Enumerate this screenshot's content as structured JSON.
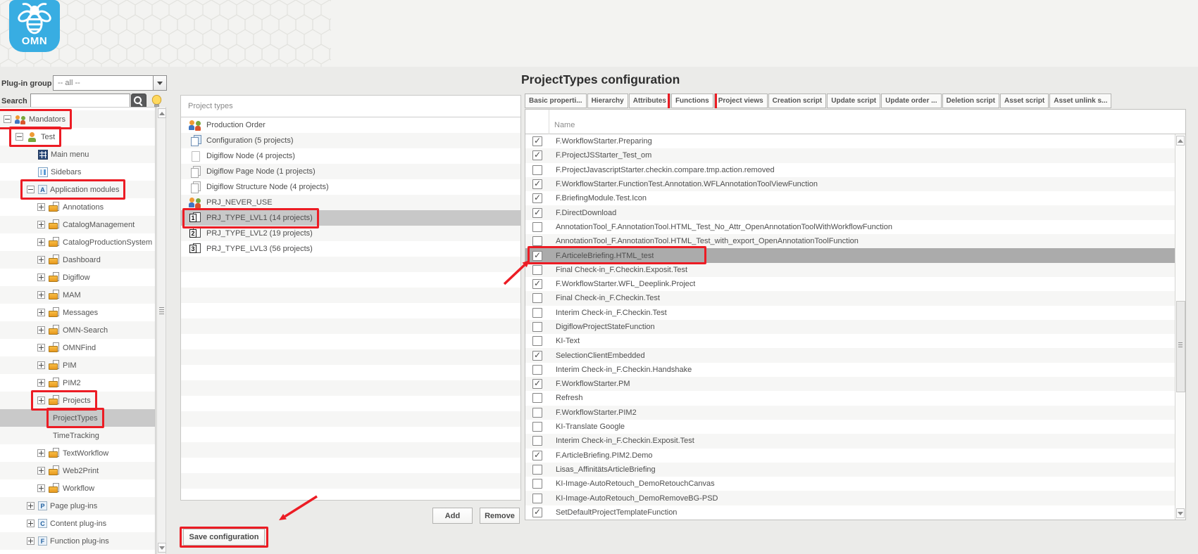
{
  "header": {
    "logo_text": "OMN"
  },
  "title": "ProjectTypes configuration",
  "sidebar": {
    "plugin_group_label": "Plug-in group",
    "plugin_group_value": "-- all --",
    "search_label": "Search",
    "search_value": "",
    "tree": [
      {
        "label": "Mandators",
        "level": 0,
        "expander": "minus",
        "icon": "users",
        "annotated": true
      },
      {
        "label": "Test",
        "level": 1,
        "expander": "minus",
        "icon": "person",
        "annotated": true
      },
      {
        "label": "Main menu",
        "level": 2,
        "expander": "none",
        "icon": "menu"
      },
      {
        "label": "Sidebars",
        "level": 2,
        "expander": "none",
        "icon": "sidebars"
      },
      {
        "label": "Application modules",
        "level": 2,
        "expander": "minus",
        "icon": "letter",
        "letter": "A",
        "annotated": true
      },
      {
        "label": "Annotations",
        "level": 3,
        "expander": "plus",
        "icon": "folder"
      },
      {
        "label": "CatalogManagement",
        "level": 3,
        "expander": "plus",
        "icon": "folder"
      },
      {
        "label": "CatalogProductionSystem",
        "level": 3,
        "expander": "plus",
        "icon": "folder"
      },
      {
        "label": "Dashboard",
        "level": 3,
        "expander": "plus",
        "icon": "folder"
      },
      {
        "label": "Digiflow",
        "level": 3,
        "expander": "plus",
        "icon": "folder"
      },
      {
        "label": "MAM",
        "level": 3,
        "expander": "plus",
        "icon": "folder"
      },
      {
        "label": "Messages",
        "level": 3,
        "expander": "plus",
        "icon": "folder"
      },
      {
        "label": "OMN-Search",
        "level": 3,
        "expander": "plus",
        "icon": "folder"
      },
      {
        "label": "OMNFind",
        "level": 3,
        "expander": "plus",
        "icon": "folder"
      },
      {
        "label": "PIM",
        "level": 3,
        "expander": "plus",
        "icon": "folder"
      },
      {
        "label": "PIM2",
        "level": 3,
        "expander": "plus",
        "icon": "folder"
      },
      {
        "label": "Projects",
        "level": 3,
        "expander": "plus",
        "icon": "folder",
        "annotated": true
      },
      {
        "label": "ProjectTypes",
        "level": 4,
        "expander": "blank",
        "icon": "none",
        "selected": true,
        "annotated": true
      },
      {
        "label": "TimeTracking",
        "level": 4,
        "expander": "blank",
        "icon": "none"
      },
      {
        "label": "TextWorkflow",
        "level": 3,
        "expander": "plus",
        "icon": "folder"
      },
      {
        "label": "Web2Print",
        "level": 3,
        "expander": "plus",
        "icon": "folder"
      },
      {
        "label": "Workflow",
        "level": 3,
        "expander": "plus",
        "icon": "folder"
      },
      {
        "label": "Page plug-ins",
        "level": 2,
        "expander": "plus",
        "icon": "letter",
        "letter": "P"
      },
      {
        "label": "Content plug-ins",
        "level": 2,
        "expander": "plus",
        "icon": "letter",
        "letter": "C"
      },
      {
        "label": "Function plug-ins",
        "level": 2,
        "expander": "plus",
        "icon": "letter",
        "letter": "F"
      }
    ]
  },
  "project_types": {
    "header": "Project types",
    "rows": [
      {
        "label": "Production Order",
        "icon": "users2"
      },
      {
        "label": "Configuration (5 projects)",
        "icon": "stack"
      },
      {
        "label": "Digiflow Node (4 projects)",
        "icon": "doc"
      },
      {
        "label": "Digiflow Page Node (1 projects)",
        "icon": "docs"
      },
      {
        "label": "Digiflow Structure Node (4 projects)",
        "icon": "docs"
      },
      {
        "label": "PRJ_NEVER_USE",
        "icon": "users2"
      },
      {
        "label": "PRJ_TYPE_LVL1 (14 projects)",
        "icon": "numdoc",
        "letter": "1",
        "selected": true,
        "annotated": true
      },
      {
        "label": "PRJ_TYPE_LVL2 (19 projects)",
        "icon": "numdoc",
        "letter": "2"
      },
      {
        "label": "PRJ_TYPE_LVL3 (56 projects)",
        "icon": "numdoc",
        "letter": "3"
      }
    ],
    "add_label": "Add",
    "remove_label": "Remove",
    "save_label": "Save configuration"
  },
  "tabs": [
    {
      "label": "Basic properti..."
    },
    {
      "label": "Hierarchy"
    },
    {
      "label": "Attributes"
    },
    {
      "label": "Functions",
      "active": true,
      "annotated": true
    },
    {
      "label": "Project views"
    },
    {
      "label": "Creation script"
    },
    {
      "label": "Update script"
    },
    {
      "label": "Update order ..."
    },
    {
      "label": "Deletion script"
    },
    {
      "label": "Asset script"
    },
    {
      "label": "Asset unlink s..."
    }
  ],
  "functions": {
    "name_header": "Name",
    "rows": [
      {
        "name": "F.WorkflowStarter.Preparing",
        "checked": true
      },
      {
        "name": "F.ProjectJSStarter_Test_om",
        "checked": true
      },
      {
        "name": "F.ProjectJavascriptStarter.checkin.compare.tmp.action.removed",
        "checked": false
      },
      {
        "name": "F.WorkflowStarter.FunctionTest.Annotation.WFLAnnotationToolViewFunction",
        "checked": true
      },
      {
        "name": "F.BriefingModule.Test.Icon",
        "checked": true
      },
      {
        "name": "F.DirectDownload",
        "checked": true
      },
      {
        "name": "AnnotationTool_F.AnnotationTool.HTML_Test_No_Attr_OpenAnnotationToolWithWorkflowFunction",
        "checked": false
      },
      {
        "name": "AnnotationTool_F.AnnotationTool.HTML_Test_with_export_OpenAnnotationToolFunction",
        "checked": false
      },
      {
        "name": "F.ArticeleBriefing.HTML_test",
        "checked": true,
        "selected": true,
        "annotated": true
      },
      {
        "name": "Final Check-in_F.Checkin.Exposit.Test",
        "checked": false
      },
      {
        "name": "F.WorkflowStarter.WFL_Deeplink.Project",
        "checked": true
      },
      {
        "name": "Final Check-in_F.Checkin.Test",
        "checked": false
      },
      {
        "name": "Interim Check-in_F.Checkin.Test",
        "checked": false
      },
      {
        "name": "DigiflowProjectStateFunction",
        "checked": false
      },
      {
        "name": "KI-Text",
        "checked": false
      },
      {
        "name": "SelectionClientEmbedded",
        "checked": true
      },
      {
        "name": "Interim Check-in_F.Checkin.Handshake",
        "checked": false
      },
      {
        "name": "F.WorkflowStarter.PM",
        "checked": true
      },
      {
        "name": "Refresh",
        "checked": false
      },
      {
        "name": "F.WorkflowStarter.PIM2",
        "checked": false
      },
      {
        "name": "KI-Translate Google",
        "checked": false
      },
      {
        "name": "Interim Check-in_F.Checkin.Exposit.Test",
        "checked": false
      },
      {
        "name": "F.ArticleBriefing.PIM2.Demo",
        "checked": true
      },
      {
        "name": "Lisas_AffinitätsArticleBriefing",
        "checked": false
      },
      {
        "name": "KI-Image-AutoRetouch_DemoRetouchCanvas",
        "checked": false
      },
      {
        "name": "KI-Image-AutoRetouch_DemoRemoveBG-PSD",
        "checked": false
      },
      {
        "name": "SetDefaultProjectTemplateFunction",
        "checked": true
      }
    ]
  },
  "colors": {
    "logo_blue": "#38ade2",
    "annotation_red": "#ec1c24",
    "selection_gray": "#ababab"
  }
}
